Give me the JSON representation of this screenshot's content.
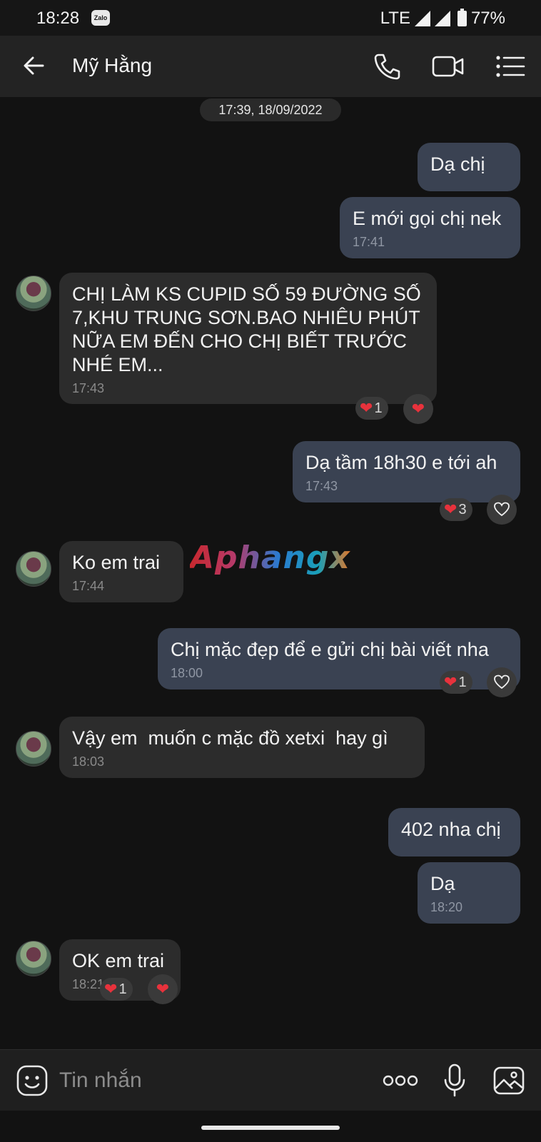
{
  "status_bar": {
    "time": "18:28",
    "app_icon": "Zalo",
    "network": "LTE",
    "battery": "77%"
  },
  "header": {
    "contact_name": "Mỹ Hằng"
  },
  "chat": {
    "date_separator": "17:39, 18/09/2022",
    "messages": [
      {
        "side": "out",
        "text": "Dạ chị",
        "time": ""
      },
      {
        "side": "out",
        "text": "E mới gọi chị nek",
        "time": "17:41"
      },
      {
        "side": "in",
        "text": "CHỊ LÀM KS CUPID SỐ 59 ĐƯỜNG SỐ 7,KHU TRUNG SƠN.BAO NHIÊU PHÚT NỮA EM ĐẾN CHO CHỊ BIẾT TRƯỚC NHÉ EM...",
        "time": "17:43",
        "reaction_count": "1"
      },
      {
        "side": "out",
        "text": "Dạ tầm 18h30 e tới ah",
        "time": "17:43",
        "reaction_count": "3"
      },
      {
        "side": "in",
        "text": "Ko em trai",
        "time": "17:44"
      },
      {
        "side": "out",
        "text": "Chị mặc đẹp để e gửi chị bài viết nha",
        "time": "18:00",
        "reaction_count": "1"
      },
      {
        "side": "in",
        "text": "Vậy em  muốn c mặc đồ xetxi  hay gì",
        "time": "18:03"
      },
      {
        "side": "out",
        "text": "402 nha chị",
        "time": ""
      },
      {
        "side": "out",
        "text": "Dạ",
        "time": "18:20"
      },
      {
        "side": "in",
        "text": "OK em trai",
        "time": "18:21",
        "reaction_count": "1"
      }
    ],
    "watermark": "Aphangx"
  },
  "composer": {
    "placeholder": "Tin nhắn"
  },
  "colors": {
    "outgoing_bubble": "#3a4252",
    "incoming_bubble": "#2c2c2c",
    "heart": "#e8323c",
    "background": "#121212"
  }
}
